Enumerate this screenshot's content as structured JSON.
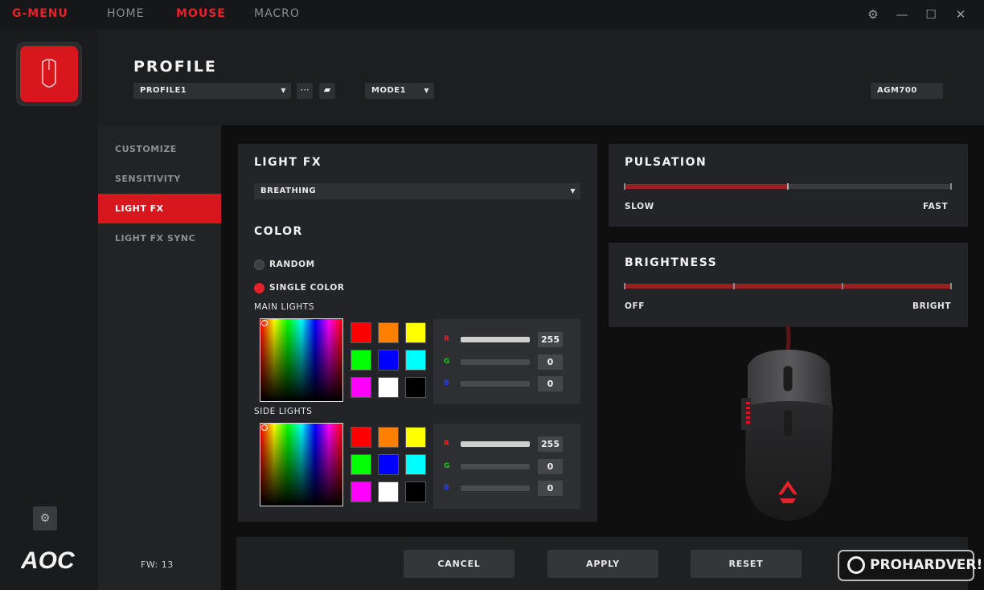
{
  "topbar": {
    "brand": "G-MENU",
    "tabs": [
      "HOME",
      "MOUSE",
      "MACRO"
    ],
    "active_tab": "MOUSE"
  },
  "header": {
    "title": "PROFILE",
    "profile_select": "PROFILE1",
    "mode_select": "MODE1",
    "device_model": "AGM700"
  },
  "sidebar": {
    "items": [
      "CUSTOMIZE",
      "SENSITIVITY",
      "LIGHT FX",
      "LIGHT FX SYNC"
    ],
    "selected": "LIGHT FX",
    "fw": "FW: 13",
    "logo": "AOC"
  },
  "lightfx": {
    "title": "LIGHT FX",
    "effect": "BREATHING",
    "color_title": "COLOR",
    "random_label": "RANDOM",
    "single_label": "SINGLE COLOR",
    "selected_mode": "SINGLE COLOR",
    "main_lights_label": "MAIN LIGHTS",
    "side_lights_label": "SIDE LIGHTS",
    "swatches": [
      "#ff0000",
      "#ff8000",
      "#ffff00",
      "#00ff00",
      "#0000ff",
      "#00ffff",
      "#ff00ff",
      "#ffffff",
      "#000000"
    ],
    "main_rgb": {
      "r_label": "R",
      "g_label": "G",
      "b_label": "B",
      "r": "255",
      "g": "0",
      "b": "0"
    },
    "side_rgb": {
      "r_label": "R",
      "g_label": "G",
      "b_label": "B",
      "r": "255",
      "g": "0",
      "b": "0"
    }
  },
  "pulsation": {
    "title": "PULSATION",
    "min_label": "SLOW",
    "max_label": "FAST",
    "level_fraction": 0.5
  },
  "brightness": {
    "title": "BRIGHTNESS",
    "min_label": "OFF",
    "max_label": "BRIGHT",
    "level_fraction": 1.0
  },
  "actions": {
    "cancel": "CANCEL",
    "apply": "APPLY",
    "reset": "RESET"
  },
  "watermark": "PROHARDVER!",
  "colors": {
    "accent": "#d7161d",
    "slider_fill": "#9c1f22"
  }
}
